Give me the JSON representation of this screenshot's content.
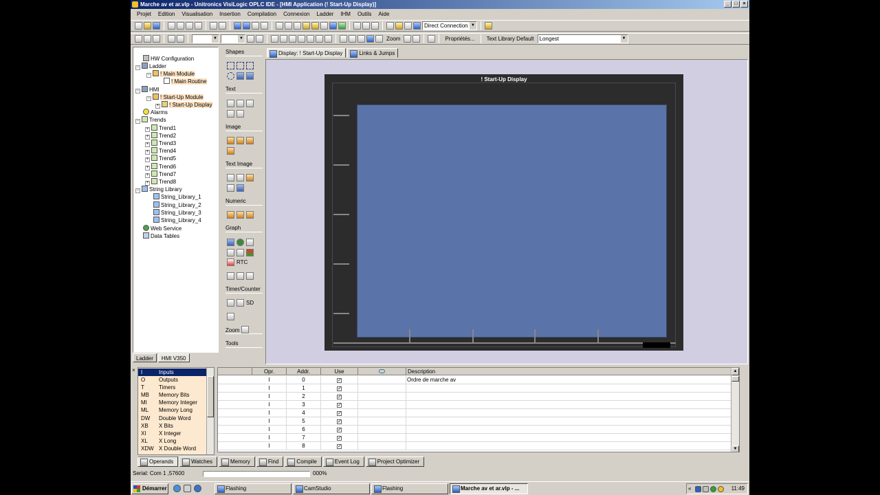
{
  "window": {
    "title": "Marche av et ar.vlp - Unitronics VisiLogic OPLC IDE - [HMI Application (! Start-Up Display)]"
  },
  "menu": [
    "Projet",
    "Edition",
    "Visualisation",
    "Insertion",
    "Compilation",
    "Connexion",
    "Ladder",
    "IHM",
    "Outils",
    "Aide"
  ],
  "toolbar": {
    "connection": "Direct Connection",
    "zoom_label": "Zoom",
    "properties_label": "Propriétés...",
    "text_library_label": "Text Library Default",
    "text_library_value": "Longest"
  },
  "tree": {
    "hw_config": "HW Configuration",
    "ladder": "Ladder",
    "main_module": "! Main Module",
    "main_routine": "! Main Routine",
    "hmi": "HMI",
    "startup_module": "! Start-Up Module",
    "startup_display": "! Start-Up Display",
    "alarms": "Alarms",
    "trends": "Trends",
    "trend_items": [
      "Trend1",
      "Trend2",
      "Trend3",
      "Trend4",
      "Trend5",
      "Trend6",
      "Trend7",
      "Trend8"
    ],
    "string_library": "String Library",
    "string_items": [
      "String_Library_1",
      "String_Library_2",
      "String_Library_3",
      "String_Library_4"
    ],
    "web_service": "Web Service",
    "data_tables": "Data Tables"
  },
  "left_tabs": {
    "ladder": "Ladder",
    "hmi": "HMI V350"
  },
  "palette": {
    "shapes": "Shapes",
    "text": "Text",
    "image": "Image",
    "text_image": "Text Image",
    "numeric": "Numeric",
    "graph": "Graph",
    "rtc": "RTC",
    "timer_counter": "Timer/Counter",
    "sd": "SD",
    "zoom": "Zoom",
    "tools": "Tools"
  },
  "doc_tabs": {
    "display": "Display: ! Start-Up Display",
    "links": "Links & Jumps"
  },
  "hmi": {
    "title": "! Start-Up Display"
  },
  "operands": [
    {
      "code": "I",
      "name": "Inputs"
    },
    {
      "code": "O",
      "name": "Outputs"
    },
    {
      "code": "T",
      "name": "Timers"
    },
    {
      "code": "MB",
      "name": "Memory Bits"
    },
    {
      "code": "MI",
      "name": "Memory Integer"
    },
    {
      "code": "ML",
      "name": "Memory Long"
    },
    {
      "code": "DW",
      "name": "Double Word"
    },
    {
      "code": "XB",
      "name": "X Bits"
    },
    {
      "code": "XI",
      "name": "X Integer"
    },
    {
      "code": "XL",
      "name": "X Long"
    },
    {
      "code": "XDW",
      "name": "X Double Word"
    }
  ],
  "grid": {
    "headers": {
      "opr": "Opr.",
      "addr": "Addr.",
      "use": "Use",
      "desc": "Description"
    },
    "rows": [
      {
        "opr": "I",
        "addr": "0",
        "desc": "Ordre de marche av"
      },
      {
        "opr": "I",
        "addr": "1",
        "desc": ""
      },
      {
        "opr": "I",
        "addr": "2",
        "desc": ""
      },
      {
        "opr": "I",
        "addr": "3",
        "desc": ""
      },
      {
        "opr": "I",
        "addr": "4",
        "desc": ""
      },
      {
        "opr": "I",
        "addr": "5",
        "desc": ""
      },
      {
        "opr": "I",
        "addr": "6",
        "desc": ""
      },
      {
        "opr": "I",
        "addr": "7",
        "desc": ""
      },
      {
        "opr": "I",
        "addr": "8",
        "desc": ""
      }
    ]
  },
  "bottom_tabs": [
    "Operands",
    "Watches",
    "Memory",
    "Find",
    "Compile",
    "Event Log",
    "Project Optimizer"
  ],
  "status": {
    "serial": "Serial:  Com 1 ,57600",
    "percent": "000%",
    "progress": 0
  },
  "taskbar": {
    "start": "Démarrer",
    "tasks": [
      "Flashing",
      "CamStudio",
      "Flashing",
      "Marche av et ar.vlp - ..."
    ],
    "clock": "11:49"
  },
  "colors": {
    "hmi_screen": "#5a73a8",
    "canvas_bg": "#d2cee2",
    "selection": "#0a246a",
    "operand_bg": "#fde9cf"
  }
}
